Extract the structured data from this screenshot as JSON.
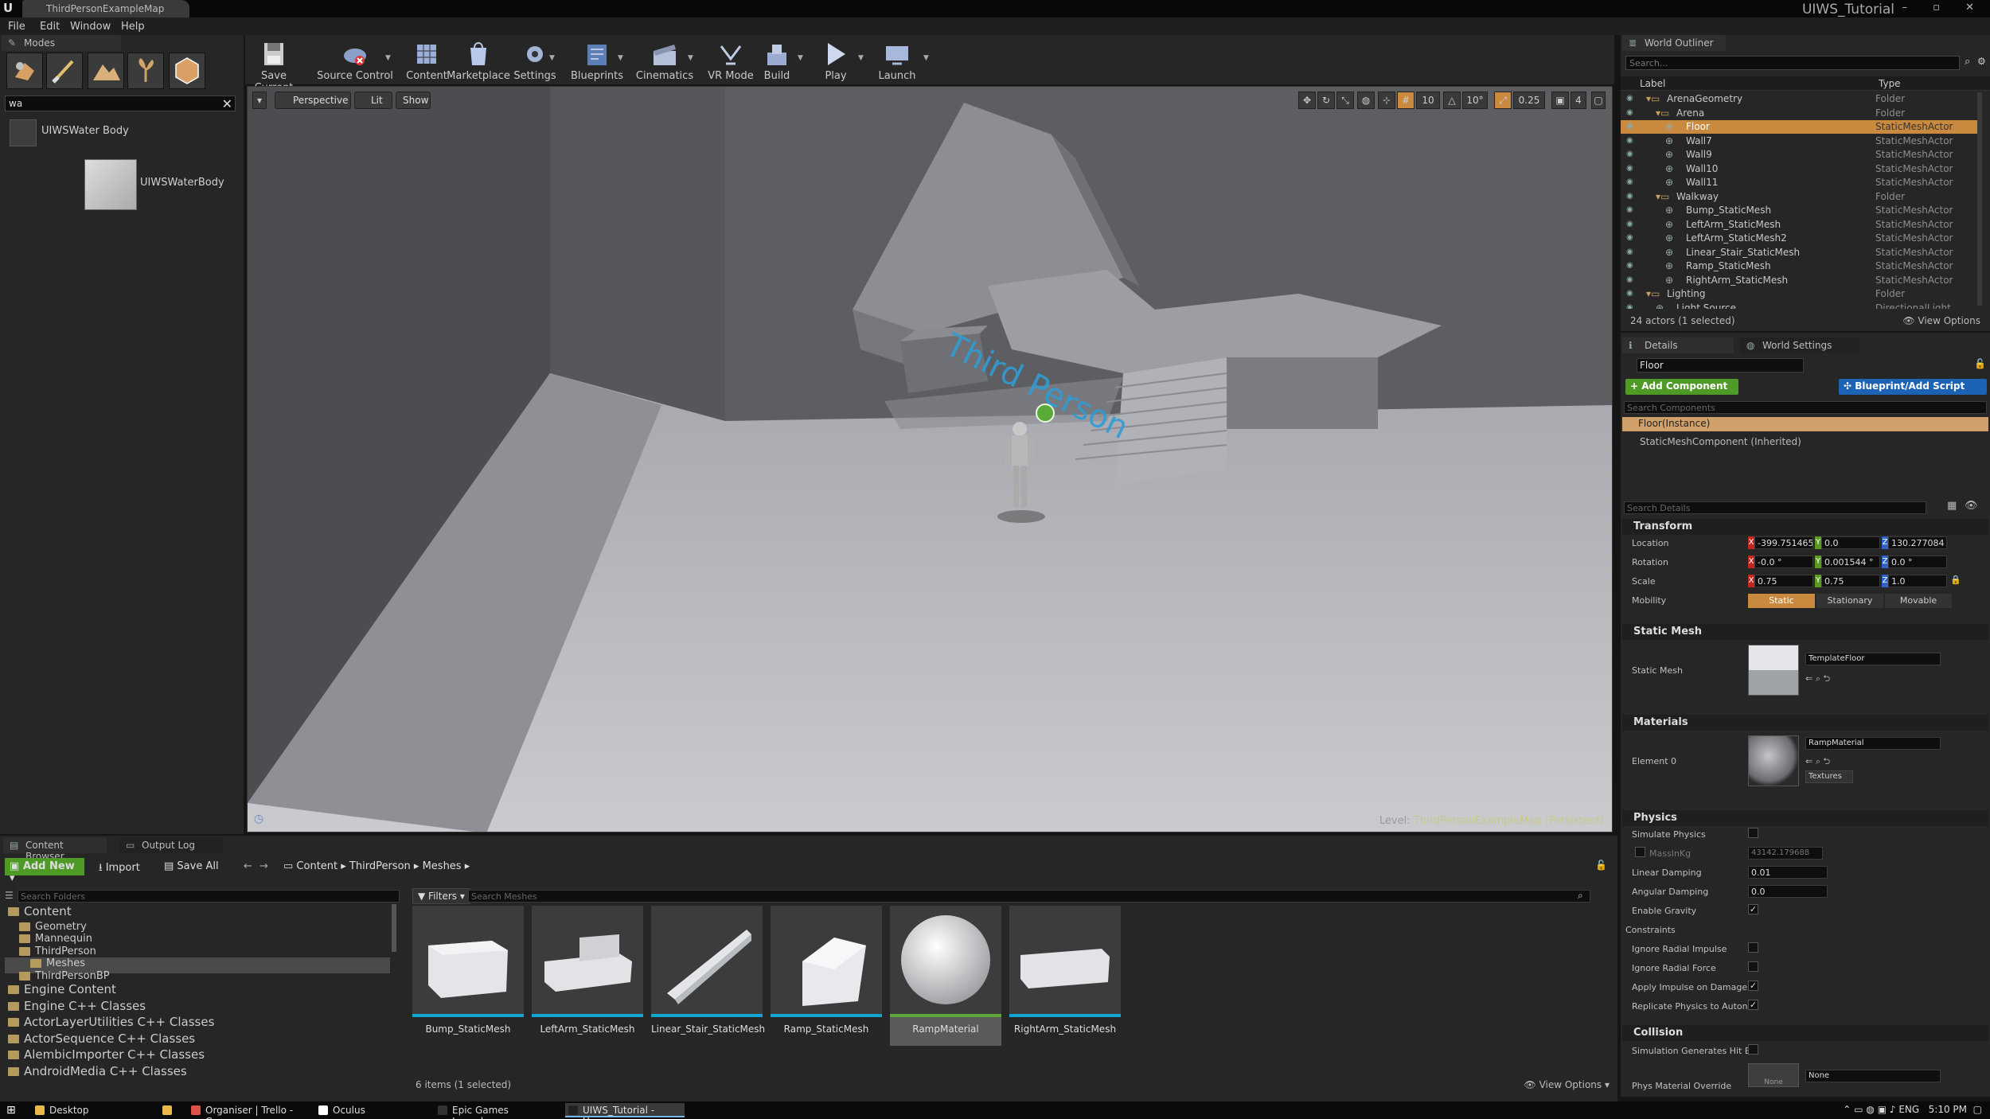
{
  "window": {
    "tab_title": "ThirdPersonExampleMap",
    "project_name": "UIWS_Tutorial",
    "controls": "–  ▫  ✕"
  },
  "menu": [
    "File",
    "Edit",
    "Window",
    "Help"
  ],
  "modes_panel": {
    "tab_label": "Modes",
    "search_value": "wa",
    "results": [
      {
        "label": "UIWSWater Body",
        "highlight": "Wa"
      }
    ],
    "thumbnail_label": "UIWSWaterBody"
  },
  "toolbar": {
    "buttons": [
      "Save Current",
      "Source Control",
      "Content",
      "Marketplace",
      "Settings",
      "Blueprints",
      "Cinematics",
      "VR Mode",
      "Build",
      "Play",
      "Launch"
    ]
  },
  "viewport": {
    "view_mode_buttons": [
      "Perspective",
      "Lit",
      "Show"
    ],
    "grid_snap": "10",
    "rotation_snap": "10°",
    "scale_snap": "0.25",
    "camera_speed": "4",
    "level_label": "Level:",
    "level_name": "ThirdPersonExampleMap (Persistent)",
    "floor_text": "Third Person"
  },
  "world_outliner": {
    "tab_label": "World Outliner",
    "search_placeholder": "Search...",
    "columns": {
      "label": "Label",
      "type": "Type"
    },
    "rows": [
      {
        "label": "ArenaGeometry",
        "type": "Folder",
        "indent": 1,
        "kind": "folder"
      },
      {
        "label": "Arena",
        "type": "Folder",
        "indent": 2,
        "kind": "folder"
      },
      {
        "label": "Floor",
        "type": "StaticMeshActor",
        "indent": 3,
        "kind": "actor",
        "selected": true
      },
      {
        "label": "Wall7",
        "type": "StaticMeshActor",
        "indent": 3,
        "kind": "actor"
      },
      {
        "label": "Wall9",
        "type": "StaticMeshActor",
        "indent": 3,
        "kind": "actor"
      },
      {
        "label": "Wall10",
        "type": "StaticMeshActor",
        "indent": 3,
        "kind": "actor"
      },
      {
        "label": "Wall11",
        "type": "StaticMeshActor",
        "indent": 3,
        "kind": "actor"
      },
      {
        "label": "Walkway",
        "type": "Folder",
        "indent": 2,
        "kind": "folder"
      },
      {
        "label": "Bump_StaticMesh",
        "type": "StaticMeshActor",
        "indent": 3,
        "kind": "actor"
      },
      {
        "label": "LeftArm_StaticMesh",
        "type": "StaticMeshActor",
        "indent": 3,
        "kind": "actor"
      },
      {
        "label": "LeftArm_StaticMesh2",
        "type": "StaticMeshActor",
        "indent": 3,
        "kind": "actor"
      },
      {
        "label": "Linear_Stair_StaticMesh",
        "type": "StaticMeshActor",
        "indent": 3,
        "kind": "actor"
      },
      {
        "label": "Ramp_StaticMesh",
        "type": "StaticMeshActor",
        "indent": 3,
        "kind": "actor"
      },
      {
        "label": "RightArm_StaticMesh",
        "type": "StaticMeshActor",
        "indent": 3,
        "kind": "actor"
      },
      {
        "label": "Lighting",
        "type": "Folder",
        "indent": 1,
        "kind": "folder"
      },
      {
        "label": "Light Source",
        "type": "DirectionalLight",
        "indent": 2,
        "kind": "actor"
      }
    ],
    "status": "24 actors (1 selected)",
    "view_options": "View Options"
  },
  "details": {
    "tab_label": "Details",
    "tab2_label": "World Settings",
    "actor_name": "Floor",
    "add_component": "+ Add Component",
    "blueprint_button": "Blueprint/Add Script",
    "search_components_placeholder": "Search Components",
    "components": [
      "Floor(Instance)",
      "StaticMeshComponent (Inherited)"
    ],
    "search_details_placeholder": "Search Details",
    "transform": {
      "title": "Transform",
      "location_label": "Location",
      "location": [
        "-399.751465",
        "0.0",
        "130.277084"
      ],
      "rotation_label": "Rotation",
      "rotation": [
        "-0.0 °",
        "0.001544 °",
        "0.0 °"
      ],
      "scale_label": "Scale",
      "scale": [
        "0.75",
        "0.75",
        "1.0"
      ],
      "mobility_label": "Mobility",
      "mobility_options": [
        "Static",
        "Stationary",
        "Movable"
      ]
    },
    "static_mesh": {
      "title": "Static Mesh",
      "label": "Static Mesh",
      "value": "TemplateFloor"
    },
    "materials": {
      "title": "Materials",
      "label": "Element 0",
      "value": "RampMaterial",
      "textures": "Textures"
    },
    "physics": {
      "title": "Physics",
      "simulate_label": "Simulate Physics",
      "mass_label": "MassInKg",
      "mass_value": "43142.179688",
      "linear_damping_label": "Linear Damping",
      "linear_damping": "0.01",
      "angular_damping_label": "Angular Damping",
      "angular_damping": "0.0",
      "enable_gravity_label": "Enable Gravity",
      "constraints_label": "Constraints",
      "ignore_radial_impulse_label": "Ignore Radial Impulse",
      "ignore_radial_force_label": "Ignore Radial Force",
      "apply_impulse_label": "Apply Impulse on Damage",
      "replicate_label": "Replicate Physics to Autono"
    },
    "collision": {
      "title": "Collision",
      "sim_hit_label": "Simulation Generates Hit Ev",
      "phys_material_label": "Phys Material Override",
      "phys_material_value": "None",
      "thumb_text": "None"
    }
  },
  "content_browser": {
    "tab_label": "Content Browser",
    "tab2_label": "Output Log",
    "add_new": "Add New",
    "import": "Import",
    "save_all": "Save All",
    "breadcrumb": [
      "Content",
      "ThirdPerson",
      "Meshes"
    ],
    "search_folders_placeholder": "Search Folders",
    "filters": "Filters",
    "search_assets_placeholder": "Search Meshes",
    "tree": [
      {
        "label": "Content",
        "indent": 0,
        "size": "big"
      },
      {
        "label": "Geometry",
        "indent": 1,
        "size": "small"
      },
      {
        "label": "Mannequin",
        "indent": 1,
        "size": "small"
      },
      {
        "label": "ThirdPerson",
        "indent": 1,
        "size": "small"
      },
      {
        "label": "Meshes",
        "indent": 2,
        "size": "small",
        "selected": true
      },
      {
        "label": "ThirdPersonBP",
        "indent": 1,
        "size": "small"
      },
      {
        "label": "Engine Content",
        "indent": 0,
        "size": "big"
      },
      {
        "label": "Engine C++ Classes",
        "indent": 0,
        "size": "big"
      },
      {
        "label": "ActorLayerUtilities C++ Classes",
        "indent": 0,
        "size": "big"
      },
      {
        "label": "ActorSequence C++ Classes",
        "indent": 0,
        "size": "big"
      },
      {
        "label": "AlembicImporter C++ Classes",
        "indent": 0,
        "size": "big"
      },
      {
        "label": "AndroidMedia C++ Classes",
        "indent": 0,
        "size": "big"
      }
    ],
    "assets": [
      {
        "label": "Bump_StaticMesh",
        "shape": "bump"
      },
      {
        "label": "LeftArm_StaticMesh",
        "shape": "leftarm"
      },
      {
        "label": "Linear_Stair_StaticMesh",
        "shape": "stair"
      },
      {
        "label": "Ramp_StaticMesh",
        "shape": "ramp"
      },
      {
        "label": "RampMaterial",
        "shape": "sphere",
        "selected": true
      },
      {
        "label": "RightArm_StaticMesh",
        "shape": "rightarm"
      }
    ],
    "count": "6 items (1 selected)",
    "view_options": "View Options"
  },
  "taskbar": {
    "items": [
      {
        "label": "Desktop",
        "color": "#e8b94a"
      },
      {
        "label": "",
        "color": "#e8b94a"
      },
      {
        "label": "Organiser | Trello - Go...",
        "color": "#de5246"
      },
      {
        "label": "Oculus",
        "color": "#ffffff"
      },
      {
        "label": "Epic Games Launcher",
        "color": "#333333"
      },
      {
        "label": "UIWS_Tutorial - Unrea...",
        "color": "#222222",
        "active": true
      }
    ],
    "lang": "ENG",
    "time": "5:10 PM"
  },
  "colors": {
    "selection": "#c98a40",
    "add_component": "#4f9a27",
    "blueprint": "#1c63b6",
    "asset_mesh_bar": "#11a8cf",
    "asset_material_bar": "#5ca83a"
  }
}
